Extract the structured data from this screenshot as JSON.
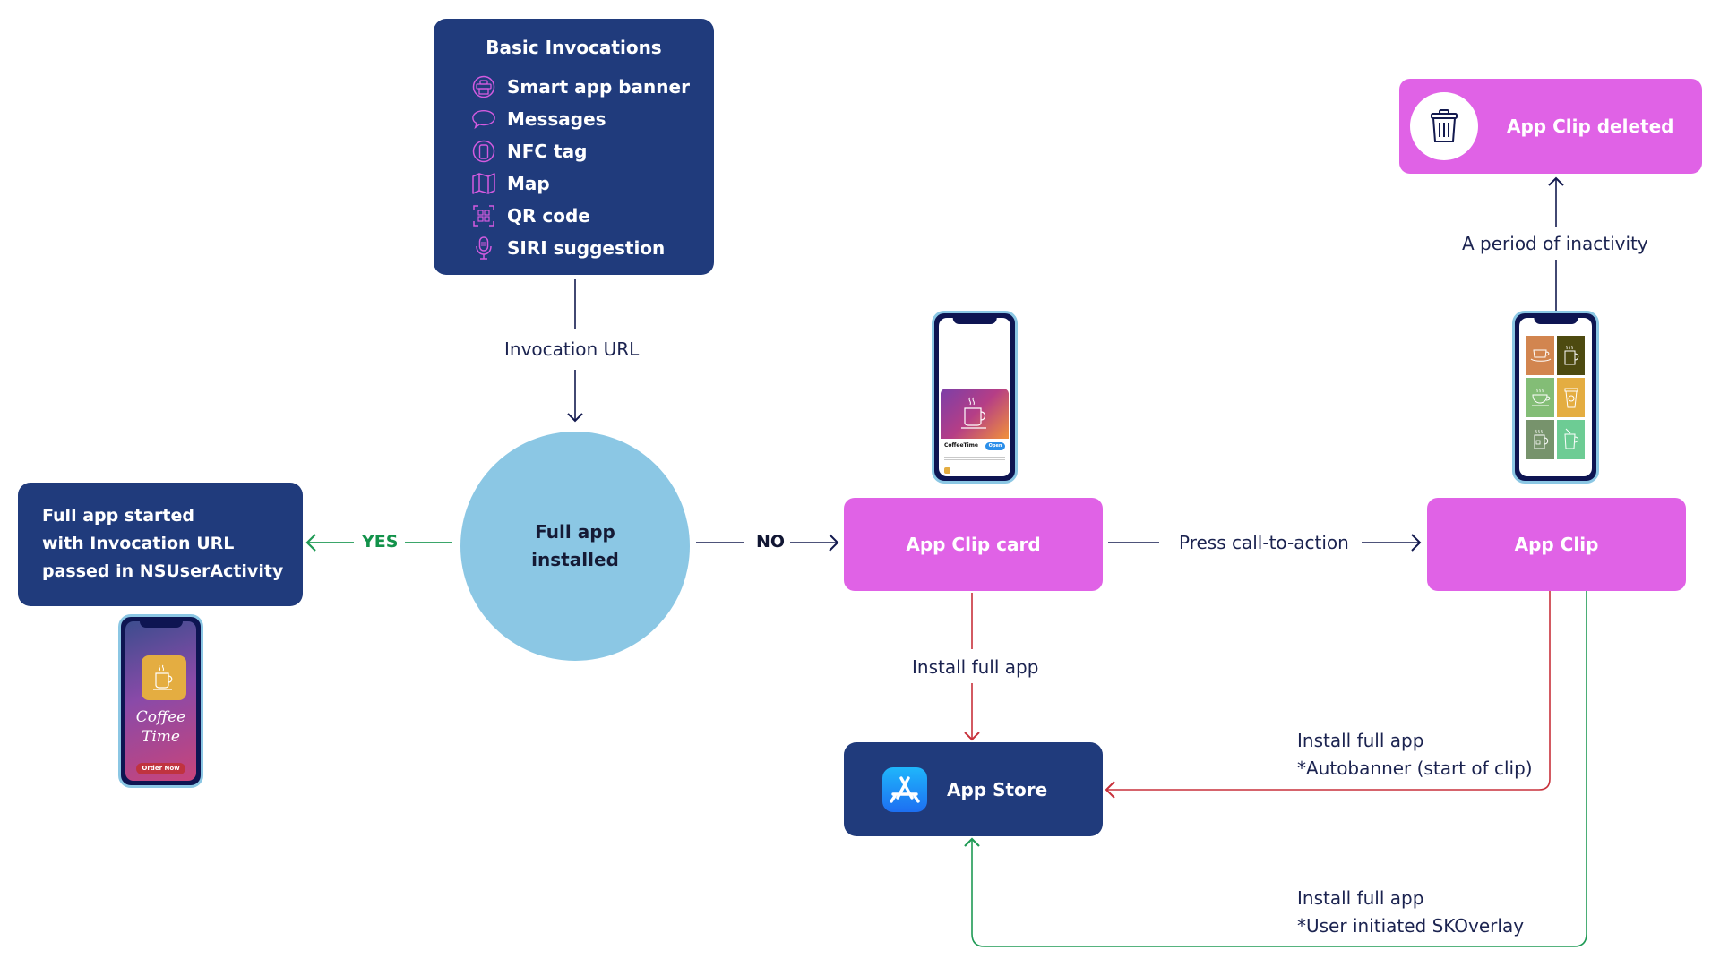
{
  "invocations": {
    "title": "Basic Invocations",
    "items": [
      {
        "label": "Smart app banner",
        "icon": "smart-banner-icon"
      },
      {
        "label": "Messages",
        "icon": "message-bubble-icon"
      },
      {
        "label": "NFC tag",
        "icon": "nfc-tag-icon"
      },
      {
        "label": "Map",
        "icon": "map-icon"
      },
      {
        "label": "QR code",
        "icon": "qr-code-icon"
      },
      {
        "label": "SIRI suggestion",
        "icon": "microphone-icon"
      }
    ]
  },
  "edges": {
    "invocation_url": "Invocation URL",
    "yes": "YES",
    "no": "NO",
    "press_cta": "Press call-to-action",
    "install_from_card": "Install full app",
    "autobanner_line1": "Install full app",
    "autobanner_line2": "*Autobanner (start of clip)",
    "skoverlay_line1": "Install full app",
    "skoverlay_line2": "*User initiated SKOverlay",
    "inactivity": "A period of inactivity"
  },
  "nodes": {
    "full_app_installed": {
      "line1": "Full app",
      "line2": "installed"
    },
    "full_app_started": {
      "line1": "Full app started",
      "line2": "with Invocation URL",
      "line3": "passed in NSUserActivity"
    },
    "app_clip_card": "App Clip card",
    "app_clip": "App Clip",
    "app_clip_deleted": "App Clip deleted",
    "app_store": "App Store"
  },
  "phones": {
    "full_app": {
      "title_line1": "Coffee",
      "title_line2": "Time",
      "button": "Order Now"
    },
    "clip_card": {
      "app_name": "CoffeeTime",
      "button": "Open"
    }
  },
  "colors": {
    "navy": "#203b7c",
    "pink": "#e062e6",
    "circle": "#8bc7e4",
    "yes_green": "#12924a",
    "red_line": "#c8313b",
    "green_line": "#1f9a55",
    "line_navy": "#131a4f",
    "icon_purple": "#d45be0"
  }
}
